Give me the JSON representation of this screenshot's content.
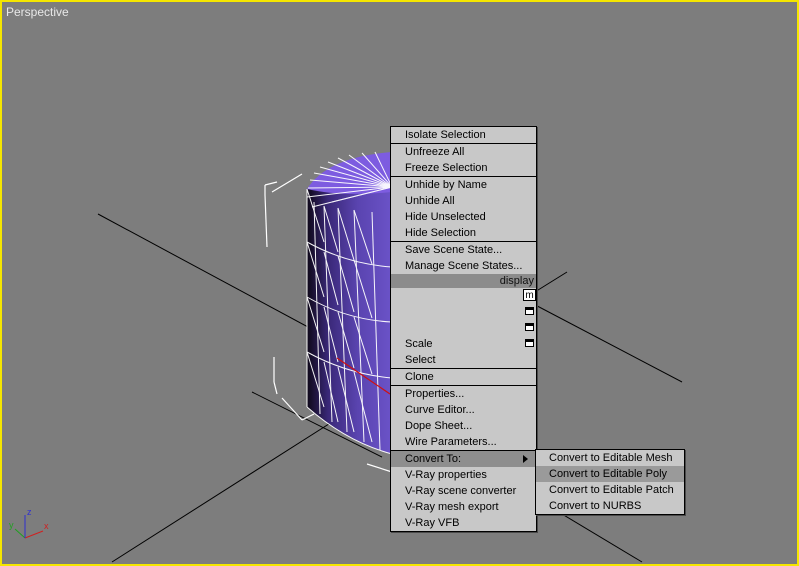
{
  "viewport": {
    "label": "Perspective",
    "border_color": "#f5e600",
    "background_color": "#7d7d7d"
  },
  "object": {
    "top_color": "#7d5ce0",
    "side_color": "#3b2a78"
  },
  "gizmo": {
    "axis_x": "x",
    "axis_y": "y",
    "axis_z": "z"
  },
  "quad_menu": {
    "groups": [
      [
        "Isolate Selection"
      ],
      [
        "Unfreeze All",
        "Freeze Selection"
      ],
      [
        "Unhide by Name",
        "Unhide All",
        "Hide Unselected",
        "Hide Selection"
      ],
      [
        "Save Scene State...",
        "Manage Scene States..."
      ]
    ],
    "display_header": "display",
    "transform_partial_label": "m",
    "transform_items": [
      "Scale",
      "Select"
    ],
    "clone_label": "Clone",
    "tools": [
      "Properties...",
      "Curve Editor...",
      "Dope Sheet...",
      "Wire Parameters..."
    ],
    "convert_to_label": "Convert To:",
    "vray": [
      "V-Ray properties",
      "V-Ray scene converter",
      "V-Ray mesh export",
      "V-Ray VFB"
    ]
  },
  "convert_submenu": {
    "items": [
      "Convert to Editable Mesh",
      "Convert to Editable Poly",
      "Convert to Editable Patch",
      "Convert to NURBS"
    ],
    "highlighted_item": "Convert to Editable Poly"
  }
}
